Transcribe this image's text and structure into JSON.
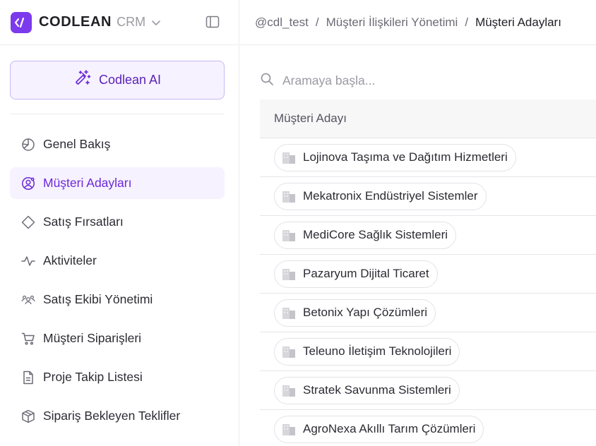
{
  "brand": {
    "logo_glyph": "</",
    "name": "CODLEAN",
    "product": "CRM",
    "accent_color": "#7c3aed"
  },
  "sidebar": {
    "ai_button_label": "Codlean AI",
    "items": [
      {
        "label": "Genel Bakış",
        "icon": "pie-chart-icon",
        "active": false
      },
      {
        "label": "Müşteri Adayları",
        "icon": "user-circle-icon",
        "active": true
      },
      {
        "label": "Satış Fırsatları",
        "icon": "diamond-icon",
        "active": false
      },
      {
        "label": "Aktiviteler",
        "icon": "activity-icon",
        "active": false
      },
      {
        "label": "Satış Ekibi Yönetimi",
        "icon": "users-icon",
        "active": false
      },
      {
        "label": "Müşteri Siparişleri",
        "icon": "shopping-cart-icon",
        "active": false
      },
      {
        "label": "Proje Takip Listesi",
        "icon": "file-text-icon",
        "active": false
      },
      {
        "label": "Sipariş Bekleyen Teklifler",
        "icon": "package-icon",
        "active": false
      }
    ]
  },
  "breadcrumb": {
    "items": [
      "@cdl_test",
      "Müşteri İlişkileri Yönetimi",
      "Müşteri Adayları"
    ],
    "separator": "/"
  },
  "search": {
    "placeholder": "Aramaya başla...",
    "value": ""
  },
  "table": {
    "column_header": "Müşteri Adayı",
    "rows": [
      "Lojinova Taşıma ve Dağıtım Hizmetleri",
      "Mekatronix Endüstriyel Sistemler",
      "MediCore Sağlık Sistemleri",
      "Pazaryum Dijital Ticaret",
      "Betonix Yapı Çözümleri",
      "Teleuno İletişim Teknolojileri",
      "Stratek Savunma Sistemleri",
      "AgroNexa Akıllı Tarım Çözümleri"
    ]
  }
}
